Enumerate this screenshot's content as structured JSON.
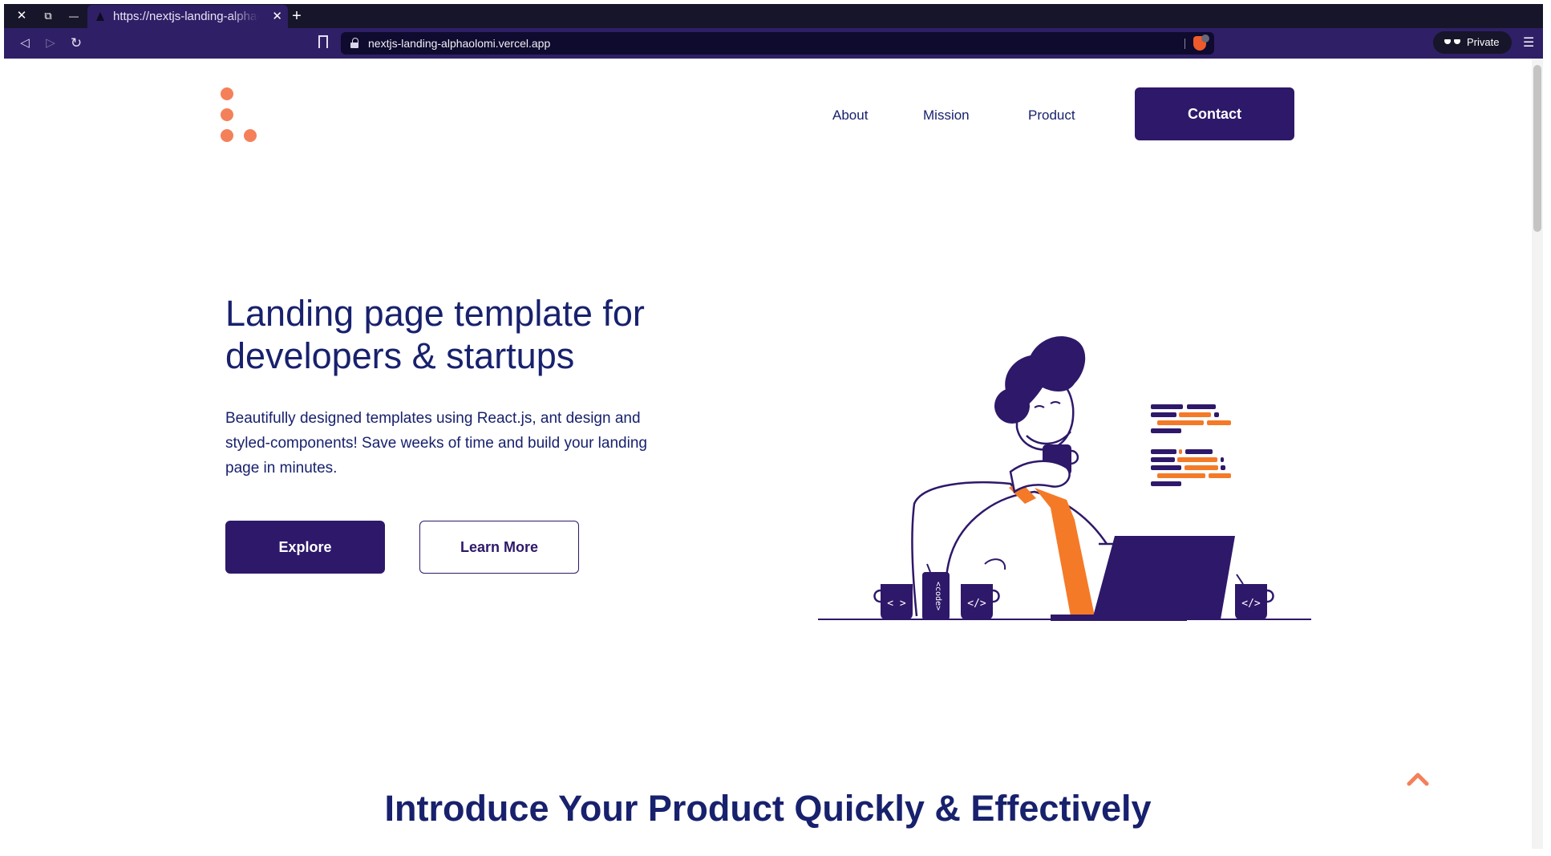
{
  "browser": {
    "tab_title": "https://nextjs-landing-alphaolomi.vercel.app",
    "url": "nextjs-landing-alphaolomi.vercel.app",
    "private_label": "Private",
    "window_controls": {
      "close_glyph": "✕",
      "restore_glyph": "⧉",
      "minimize_glyph": "—",
      "tab_close_glyph": "✕",
      "new_tab_glyph": "+"
    },
    "nav_glyphs": {
      "back": "◁",
      "forward": "▷",
      "reload": "↻",
      "menu": "☰"
    }
  },
  "header": {
    "nav": [
      {
        "label": "About"
      },
      {
        "label": "Mission"
      },
      {
        "label": "Product"
      }
    ],
    "contact_label": "Contact"
  },
  "hero": {
    "title": "Landing page template for developers & startups",
    "text": "Beautifully designed templates using React.js, ant design and styled-components! Save weeks of time and build your landing page in minutes.",
    "explore_label": "Explore",
    "learn_more_label": "Learn More"
  },
  "illustration": {
    "mug_left_label": "< >",
    "can_label": "<code>",
    "mug_middle_label": "</>",
    "mug_right_label": "</>"
  },
  "next_section": {
    "title": "Introduce Your Product Quickly & Effectively"
  },
  "colors": {
    "brand_purple": "#2e186a",
    "heading_navy": "#18216d",
    "accent_orange": "#f4805a",
    "browser_toolbar": "#2f1f66"
  }
}
